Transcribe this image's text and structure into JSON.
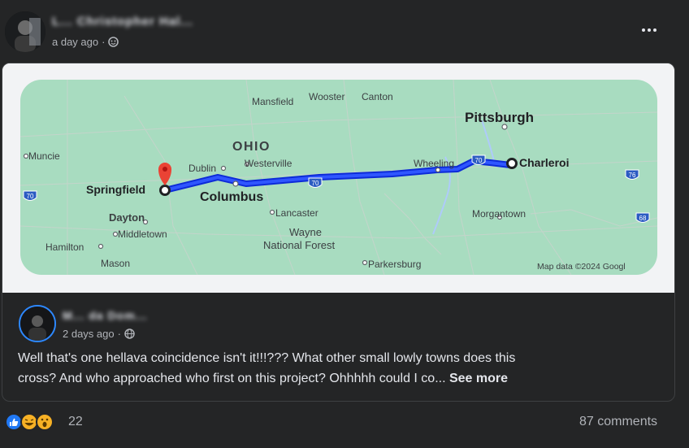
{
  "post": {
    "author_name": "L... Christopher Hal...",
    "time": "a day ago",
    "audience_icon": "friends-icon",
    "more_icon": "more-options-icon"
  },
  "map": {
    "labels": {
      "mansfield": "Mansfield",
      "wooster": "Wooster",
      "canton": "Canton",
      "pittsburgh": "Pittsburgh",
      "ohio": "OHIO",
      "muncie": "Muncie",
      "dublin": "Dublin",
      "westerville": "Westerville",
      "wheeling": "Wheeling",
      "charleroi": "Charleroi",
      "springfield": "Springfield",
      "columbus": "Columbus",
      "dayton": "Dayton",
      "lancaster": "Lancaster",
      "morgantown": "Morgantown",
      "middletown": "Middletown",
      "wayne_1": "Wayne",
      "wayne_2": "National Forest",
      "hamilton": "Hamilton",
      "mason": "Mason",
      "parkersburg": "Parkersburg",
      "map_data": "Map data ©2024 Googl"
    },
    "shields": {
      "i70_west": "70",
      "i70_mid": "70",
      "i70_east": "70",
      "i76": "76",
      "i68": "68"
    },
    "colors": {
      "land": "#a8dcc0",
      "route": "#1a3cff",
      "water": "#aecbfa",
      "pin": "#ea4335"
    }
  },
  "comment": {
    "author_name": "M... da Dom...",
    "time": "2 days ago",
    "audience_icon": "globe-icon",
    "text": "Well that's one hellava coincidence isn't it!!!??? What other small lowly towns does this cross? And who approached who first on this project? Ohhhhh could I co...",
    "see_more": "See more"
  },
  "footer": {
    "reaction_count": "22",
    "reactions": [
      "like-icon",
      "haha-icon",
      "wow-icon"
    ],
    "comments": "87 comments"
  }
}
